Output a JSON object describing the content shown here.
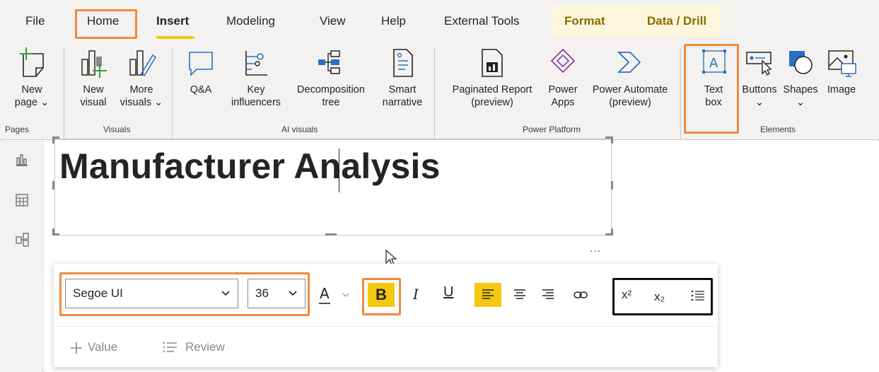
{
  "tabs": [
    {
      "label": "File"
    },
    {
      "label": "Home"
    },
    {
      "label": "Insert"
    },
    {
      "label": "Modeling"
    },
    {
      "label": "View"
    },
    {
      "label": "Help"
    },
    {
      "label": "External Tools"
    },
    {
      "label": "Format"
    },
    {
      "label": "Data / Drill"
    }
  ],
  "active_tab": "Insert",
  "ribbon": {
    "pages": {
      "new_page_line1": "New",
      "new_page_line2": "page ⌄",
      "group": "Pages"
    },
    "visuals": {
      "new_visual_line1": "New",
      "new_visual_line2": "visual",
      "more_visuals_line1": "More",
      "more_visuals_line2": "visuals ⌄",
      "group": "Visuals"
    },
    "ai_visuals": {
      "qna": "Q&A",
      "key_inf_line1": "Key",
      "key_inf_line2": "influencers",
      "decomp_line1": "Decomposition",
      "decomp_line2": "tree",
      "smart_line1": "Smart",
      "smart_line2": "narrative",
      "group": "AI visuals"
    },
    "power_platform": {
      "paginated_line1": "Paginated Report",
      "paginated_line2": "(preview)",
      "powerapps_line1": "Power",
      "powerapps_line2": "Apps",
      "automate_line1": "Power Automate",
      "automate_line2": "(preview)",
      "group": "Power Platform"
    },
    "elements": {
      "textbox_line1": "Text",
      "textbox_line2": "box",
      "buttons_line1": "Buttons",
      "buttons_line2": "⌄",
      "shapes_line1": "Shapes",
      "shapes_line2": "⌄",
      "image": "Image",
      "group": "Elements"
    }
  },
  "canvas": {
    "title": "Manufacturer Analysis",
    "more": "..."
  },
  "format_toolbar": {
    "font": "Segoe UI",
    "size": "36",
    "bold": "B",
    "italic": "I",
    "underline": "U",
    "superscript": "x²",
    "subscript": "x₂",
    "value": "Value",
    "review": "Review"
  },
  "colors": {
    "accent": "#f2c811",
    "highlight": "#f08a3c",
    "ribbon_bg": "#f3f2f1"
  }
}
